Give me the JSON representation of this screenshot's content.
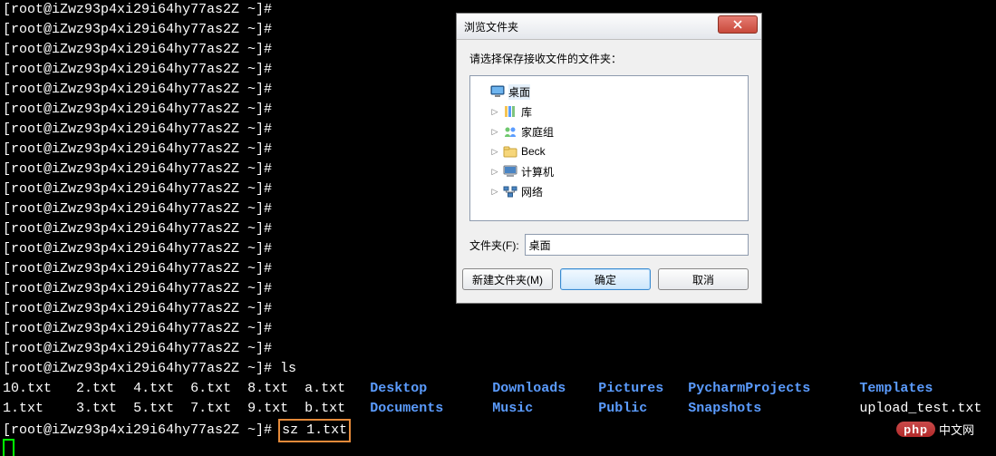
{
  "terminal": {
    "prompt": "[root@iZwz93p4xi29i64hy77as2Z ~]#",
    "ls_cmd": "ls",
    "sz_cmd": "sz 1.txt",
    "blank_prompt_count": 18,
    "files_row1": [
      {
        "name": "10.txt",
        "type": "file"
      },
      {
        "name": "2.txt",
        "type": "file"
      },
      {
        "name": "4.txt",
        "type": "file"
      },
      {
        "name": "6.txt",
        "type": "file"
      },
      {
        "name": "8.txt",
        "type": "file"
      },
      {
        "name": "a.txt",
        "type": "file"
      },
      {
        "name": "Desktop",
        "type": "dir"
      },
      {
        "name": "Downloads",
        "type": "dir"
      },
      {
        "name": "Pictures",
        "type": "dir"
      },
      {
        "name": "PycharmProjects",
        "type": "dir"
      },
      {
        "name": "Templates",
        "type": "dir"
      }
    ],
    "files_row2": [
      {
        "name": "1.txt",
        "type": "file"
      },
      {
        "name": "3.txt",
        "type": "file"
      },
      {
        "name": "5.txt",
        "type": "file"
      },
      {
        "name": "7.txt",
        "type": "file"
      },
      {
        "name": "9.txt",
        "type": "file"
      },
      {
        "name": "b.txt",
        "type": "file"
      },
      {
        "name": "Documents",
        "type": "dir"
      },
      {
        "name": "Music",
        "type": "dir"
      },
      {
        "name": "Public",
        "type": "dir"
      },
      {
        "name": "Snapshots",
        "type": "dir"
      },
      {
        "name": "upload_test.txt",
        "type": "file"
      }
    ],
    "col_starts": [
      0,
      9,
      16,
      23,
      30,
      37,
      45,
      60,
      73,
      84,
      105
    ]
  },
  "dialog": {
    "title": "浏览文件夹",
    "instruction": "请选择保存接收文件的文件夹：",
    "tree": [
      {
        "label": "桌面",
        "icon": "desktop",
        "expander": "",
        "selected": true,
        "indent": 0
      },
      {
        "label": "库",
        "icon": "libraries",
        "expander": "▷",
        "indent": 1
      },
      {
        "label": "家庭组",
        "icon": "homegroup",
        "expander": "▷",
        "indent": 1
      },
      {
        "label": "Beck",
        "icon": "user",
        "expander": "▷",
        "indent": 1
      },
      {
        "label": "计算机",
        "icon": "computer",
        "expander": "▷",
        "indent": 1
      },
      {
        "label": "网络",
        "icon": "network",
        "expander": "▷",
        "indent": 1
      }
    ],
    "folder_label": "文件夹(F):",
    "folder_value": "桌面",
    "btn_new_folder": "新建文件夹(M)",
    "btn_ok": "确定",
    "btn_cancel": "取消"
  },
  "watermark": {
    "badge": "php",
    "text": "中文网"
  }
}
